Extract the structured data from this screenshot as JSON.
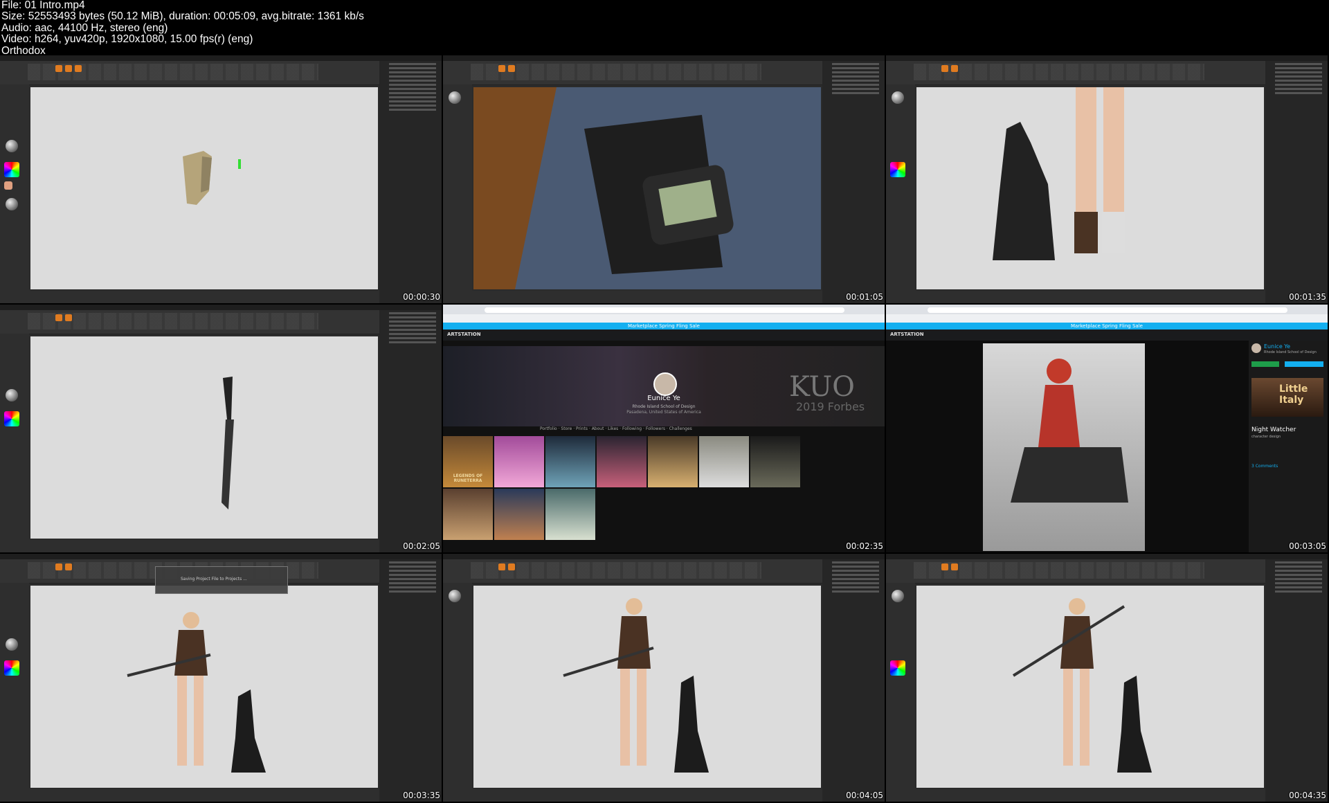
{
  "header": {
    "lines": [
      "File: 01 Intro.mp4",
      "Size: 52553493 bytes (50.12 MiB), duration: 00:05:09, avg.bitrate: 1361 kb/s",
      "Audio: aac, 44100 Hz, stereo (eng)",
      "Video: h264, yuv420p, 1920x1080, 15.00 fps(r) (eng)",
      "Orthodox"
    ]
  },
  "timestamps": [
    "00:00:30",
    "00:01:05",
    "00:01:35",
    "00:02:05",
    "00:02:35",
    "00:03:05",
    "00:03:35",
    "00:04:05",
    "00:04:35"
  ],
  "artstation_profile": {
    "brand": "ARTSTATION",
    "banner": "Marketplace Spring Fling Sale",
    "nav": [
      "ACTIVITY",
      "LEARNING",
      "MARKETPLACE",
      "PRINTS",
      "JOBS",
      "BLOGS",
      "CHALLENGES",
      "MAGAZINE",
      "BOOKS"
    ],
    "name": "Eunice Ye",
    "subtitle": "Rhode Island School of Design",
    "location": "Pasadena, United States of America",
    "cover_text": "KUO",
    "cover_sub": "2019 Forbes",
    "tabs": [
      "Portfolio",
      "Store",
      "Prints",
      "About",
      "Likes",
      "Following",
      "Followers",
      "Challenges"
    ],
    "thumb_title": "LEGENDS OF RUNETERRA"
  },
  "artstation_artwork": {
    "brand": "ARTSTATION",
    "banner": "Marketplace Spring Fling Sale",
    "author": "Eunice Ye",
    "author_sub": "Rhode Island School of Design",
    "title": "Night Watcher",
    "subtitle": "character design",
    "ad_text": "Little Italy",
    "comments_label": "3 Comments"
  },
  "zbrush_popup": "Saving Project File to Projects ...",
  "colors": {
    "zbrush_accent": "#e07b20",
    "artstation_blue": "#13aff0"
  }
}
